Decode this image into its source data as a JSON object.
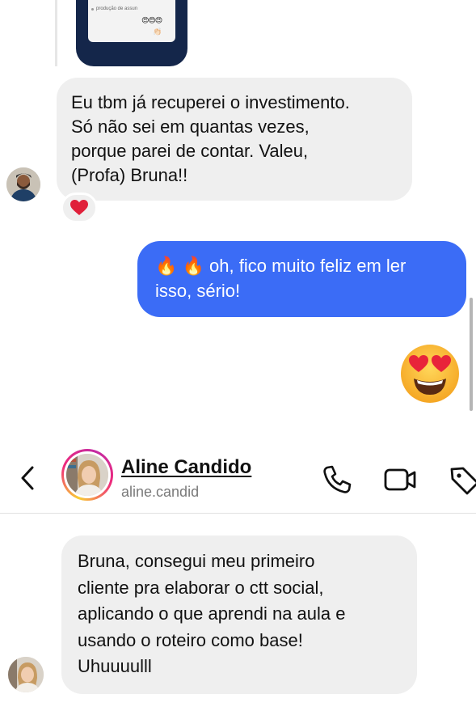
{
  "top_thread": {
    "image_message": {
      "caption": "produção de assun",
      "emojis": "😍😍😍",
      "hands": "👏🏻"
    },
    "received_message": {
      "lines": [
        "Eu tbm já recuperei o investimento.",
        "Só não sei em quantas vezes,",
        "porque parei de contar. Valeu,",
        "(Profa) Bruna!!"
      ],
      "reaction": "heart-reaction"
    },
    "sent_message": {
      "emojis": "🔥 🔥",
      "line1": "oh, fico muito feliz em ler",
      "line2": "isso, sério!"
    },
    "sent_sticker": "heart-eyes-emoji"
  },
  "header": {
    "contact_name": "Aline Candido",
    "contact_handle": "aline.candid"
  },
  "bottom_thread": {
    "received_message": {
      "lines": [
        "Bruna, consegui meu primeiro",
        "cliente pra elaborar o ctt social,",
        "aplicando o que aprendi na aula e",
        "usando o roteiro como base!",
        "Uhuuuulll"
      ]
    }
  },
  "colors": {
    "sent_bubble": "#3b6cf6",
    "received_bubble": "#efefef",
    "image_frame": "#14264a"
  }
}
